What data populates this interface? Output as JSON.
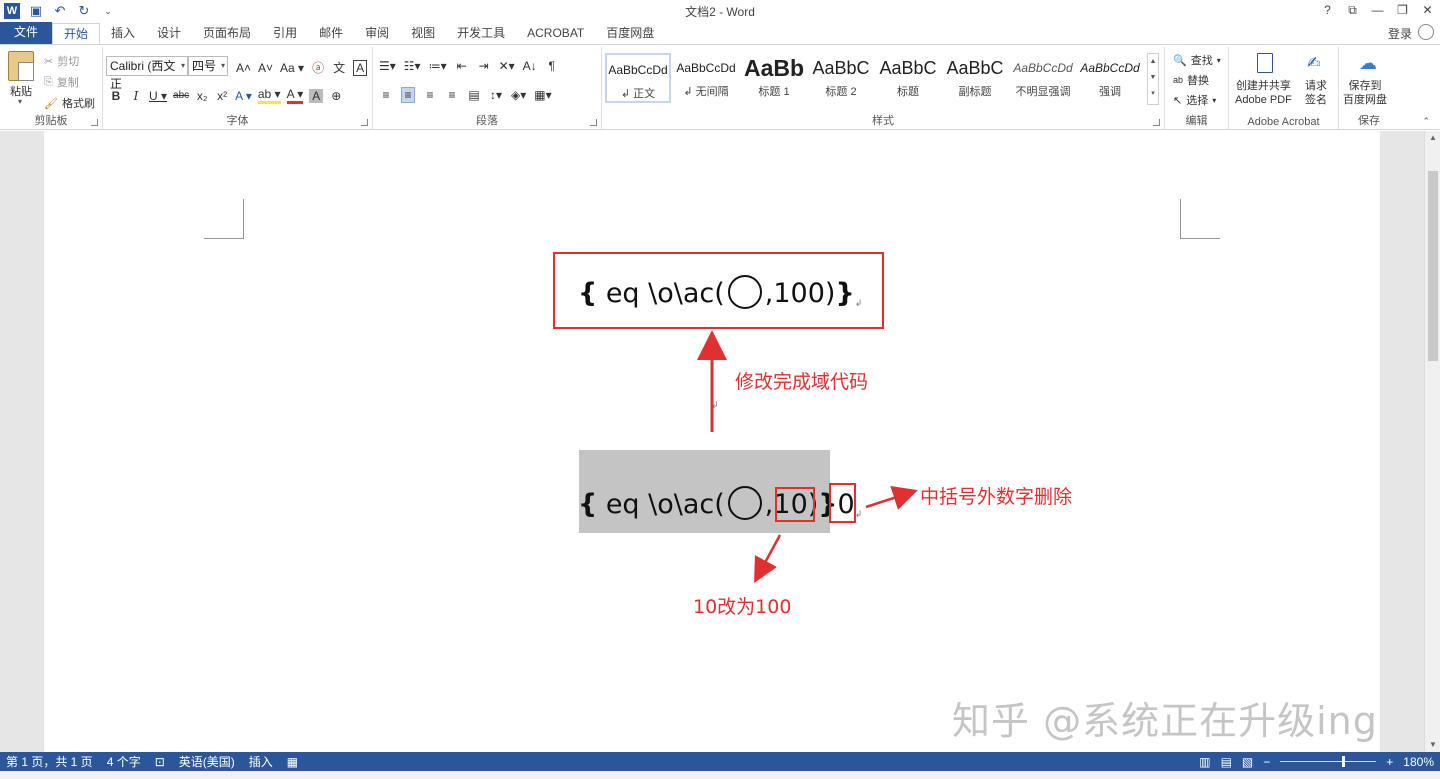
{
  "window": {
    "title": "文档2 - Word",
    "controls": [
      "?",
      "⧉",
      "—",
      "❐",
      "✕"
    ]
  },
  "qat": {
    "logo": "W",
    "save_icon": "💾",
    "undo_icon": "↶",
    "redo_icon": "↻",
    "customize": "⌄"
  },
  "tabs": [
    {
      "label": "文件"
    },
    {
      "label": "开始"
    },
    {
      "label": "插入"
    },
    {
      "label": "设计"
    },
    {
      "label": "页面布局"
    },
    {
      "label": "引用"
    },
    {
      "label": "邮件"
    },
    {
      "label": "审阅"
    },
    {
      "label": "视图"
    },
    {
      "label": "开发工具"
    },
    {
      "label": "ACROBAT"
    },
    {
      "label": "百度网盘"
    }
  ],
  "login": "登录",
  "ribbon": {
    "clipboard": {
      "paste": "粘贴",
      "cut": "剪切",
      "copy": "复制",
      "format_painter": "格式刷",
      "label": "剪贴板"
    },
    "font": {
      "name": "Calibri (西文正",
      "size": "四号",
      "label": "字体",
      "row1_icons": [
        "A˄",
        "A˅",
        "Aa ▾",
        "ⓐ",
        "文",
        "A"
      ],
      "row2_icons": [
        "B",
        "I",
        "U ▾",
        "abc",
        "x₂",
        "x²",
        "A ▾",
        "ab ▾",
        "A ▾",
        "A",
        "⊕"
      ]
    },
    "paragraph": {
      "label": "段落",
      "row1_icons": [
        "☰▾",
        "☷▾",
        "≔▾",
        "⇤",
        "⇥",
        "✕▾",
        "A↓",
        "¶"
      ],
      "row2_icons": [
        "≡",
        "≡",
        "≡",
        "≡",
        "▤",
        "↕▾",
        "◈▾",
        "▦▾"
      ]
    },
    "styles": {
      "label": "样式",
      "items": [
        {
          "sample": "AaBbCcDd",
          "name": "↲ 正文"
        },
        {
          "sample": "AaBbCcDd",
          "name": "↲ 无间隔"
        },
        {
          "sample": "AaBb",
          "name": "标题 1"
        },
        {
          "sample": "AaBbC",
          "name": "标题 2"
        },
        {
          "sample": "AaBbC",
          "name": "标题"
        },
        {
          "sample": "AaBbC",
          "name": "副标题"
        },
        {
          "sample": "AaBbCcDd",
          "name": "不明显强调"
        },
        {
          "sample": "AaBbCcDd",
          "name": "强调"
        }
      ]
    },
    "editing": {
      "find": "查找",
      "replace": "替换",
      "select": "选择",
      "label": "编辑"
    },
    "acrobat": {
      "create": "创建并共享",
      "create2": "Adobe PDF",
      "request": "请求",
      "request2": "签名",
      "label": "Adobe Acrobat"
    },
    "save": {
      "save1": "保存到",
      "save2": "百度网盘",
      "label": "保存"
    }
  },
  "document": {
    "field_top": {
      "brace_open": "{",
      "code": " eq \\o\\ac(",
      "code_end": ",100)",
      "brace_close": "}",
      "para_mark": "↲"
    },
    "field_bottom": {
      "brace_open": "{",
      "code": " eq \\o\\ac(",
      "comma": ",",
      "num": "10",
      "paren": ")",
      "brace_close": "}",
      "trail": "0",
      "para_mark": "↲"
    },
    "annotation_top": "修改完成域代码",
    "annotation_right": "中括号外数字删除",
    "annotation_bottom": "10改为100",
    "stray_mark": "↲"
  },
  "watermark": "知乎 @系统正在升级ing",
  "status": {
    "page": "第 1 页，共 1 页",
    "words": "4 个字",
    "lang": "英语(美国)",
    "mode": "插入",
    "zoom": "180%",
    "zoom_level_percent": 180,
    "minus": "−",
    "plus": "+"
  }
}
